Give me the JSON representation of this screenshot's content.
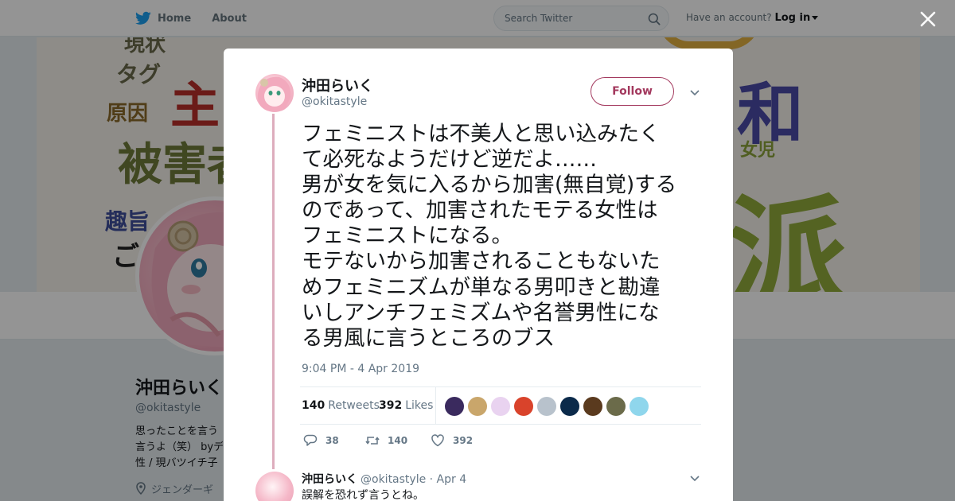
{
  "nav": {
    "home_label": "Home",
    "about_label": "About",
    "search_placeholder": "Search Twitter",
    "account_prompt": "Have an account?",
    "login_label": "Log in"
  },
  "banner_words": [
    "現状",
    "タグ",
    "主",
    "原因",
    "被害者",
    "趣旨",
    "ご",
    "和",
    "女児",
    "派"
  ],
  "profile": {
    "name": "沖田らいく",
    "handle": "@okitastyle",
    "bio_lines": [
      "思ったことを言う",
      "言うよ（笑） byデ",
      "性 / 現バツイチ子"
    ],
    "location": "ジェンダーギ"
  },
  "tweet": {
    "author_name": "沖田らいく",
    "author_handle": "@okitastyle",
    "follow_label": "Follow",
    "text_lines": [
      "フェミニストは不美人と思い込みたく",
      "て必死なようだけど逆だよ……",
      "男が女を気に入るから加害(無自覚)する",
      "のであって、加害されたモテる女性は",
      "フェミニストになる。",
      "モテないから加害されることもないた",
      "めフェミニズムが単なる男叩きと勘違",
      "いしアンチフェミズムや名誉男性にな",
      "る男風に言うところのブス"
    ],
    "timestamp": "9:04 PM - 4 Apr 2019",
    "retweets_count": "140",
    "retweets_label": "Retweets",
    "likes_count": "392",
    "likes_label": "Likes",
    "liker_colors": [
      "#3a2a5e",
      "#c9a66b",
      "#e9d3f0",
      "#d9432b",
      "#b8c2cc",
      "#0b2a4a",
      "#5a3a1e",
      "#6b6b4a",
      "#8fd6ec"
    ],
    "reply_count": "38",
    "retweet_action_count": "140",
    "like_action_count": "392"
  },
  "reply": {
    "author_name": "沖田らいく",
    "author_handle": "@okitastyle",
    "date": "· Apr 4",
    "text": "誤解を恐れず言うとね。"
  },
  "colors": {
    "twitter_blue": "#1da1f2",
    "follow_accent": "#a3395e",
    "thread_line": "#ddadbd"
  }
}
